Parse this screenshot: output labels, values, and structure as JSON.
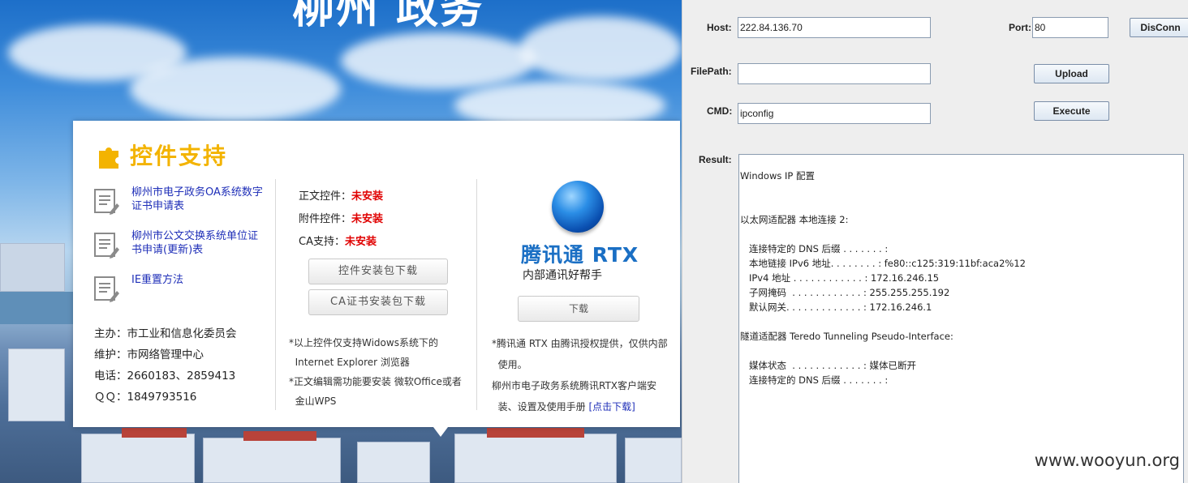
{
  "webpage": {
    "banner_title": "柳州 政务",
    "panel": {
      "title": "控件支持",
      "links": [
        {
          "label": "柳州市电子政务OA系统数字证书申请表"
        },
        {
          "label": "柳州市公文交换系统单位证书申请(更新)表"
        },
        {
          "label": "IE重置方法"
        }
      ],
      "info": [
        "主办：市工业和信息化委员会",
        "维护：市网络管理中心",
        "电话：2660183、2859413",
        "ＱＱ：1849793516"
      ],
      "status": [
        {
          "label": "正文控件：",
          "value": "未安装"
        },
        {
          "label": "附件控件：",
          "value": "未安装"
        },
        {
          "label": "CA支持：",
          "value": "未安装"
        }
      ],
      "buttons": {
        "control_pkg": "控件安装包下载",
        "ca_pkg": "CA证书安装包下载"
      },
      "notes": [
        "*以上控件仅支持Widows系统下的",
        "  Internet Explorer 浏览器",
        "*正文编辑需功能要安装 微软Office或者",
        "  金山WPS"
      ],
      "rtx": {
        "name": "腾讯通 RTX",
        "subtitle": "内部通讯好帮手",
        "download": "下载",
        "notes": [
          "*腾讯通 RTX 由腾讯授权提供，仅供内部",
          "  使用。",
          "柳州市电子政务系统腾讯RTX客户端安",
          "  装、设置及使用手册 "
        ],
        "link": "[点击下载]"
      }
    }
  },
  "tool": {
    "host_label": "Host:",
    "host_value": "222.84.136.70",
    "port_label": "Port:",
    "port_value": "80",
    "disconn_label": "DisConn",
    "filepath_label": "FilePath:",
    "filepath_value": "",
    "upload_label": "Upload",
    "cmd_label": "CMD:",
    "cmd_value": "ipconfig",
    "execute_label": "Execute",
    "result_label": "Result:",
    "result_lines": [
      "Windows IP 配置",
      "",
      "",
      "以太网适配器 本地连接 2:",
      "",
      "   连接特定的 DNS 后缀 . . . . . . . :",
      "   本地链接 IPv6 地址. . . . . . . . : fe80::c125:319:11bf:aca2%12",
      "   IPv4 地址 . . . . . . . . . . . . : 172.16.246.15",
      "   子网掩码  . . . . . . . . . . . . : 255.255.255.192",
      "   默认网关. . . . . . . . . . . . . : 172.16.246.1",
      "",
      "隧道适配器 Teredo Tunneling Pseudo-Interface:",
      "",
      "   媒体状态  . . . . . . . . . . . . : 媒体已断开",
      "   连接特定的 DNS 后缀 . . . . . . . :"
    ]
  },
  "watermark": "www.wooyun.org"
}
